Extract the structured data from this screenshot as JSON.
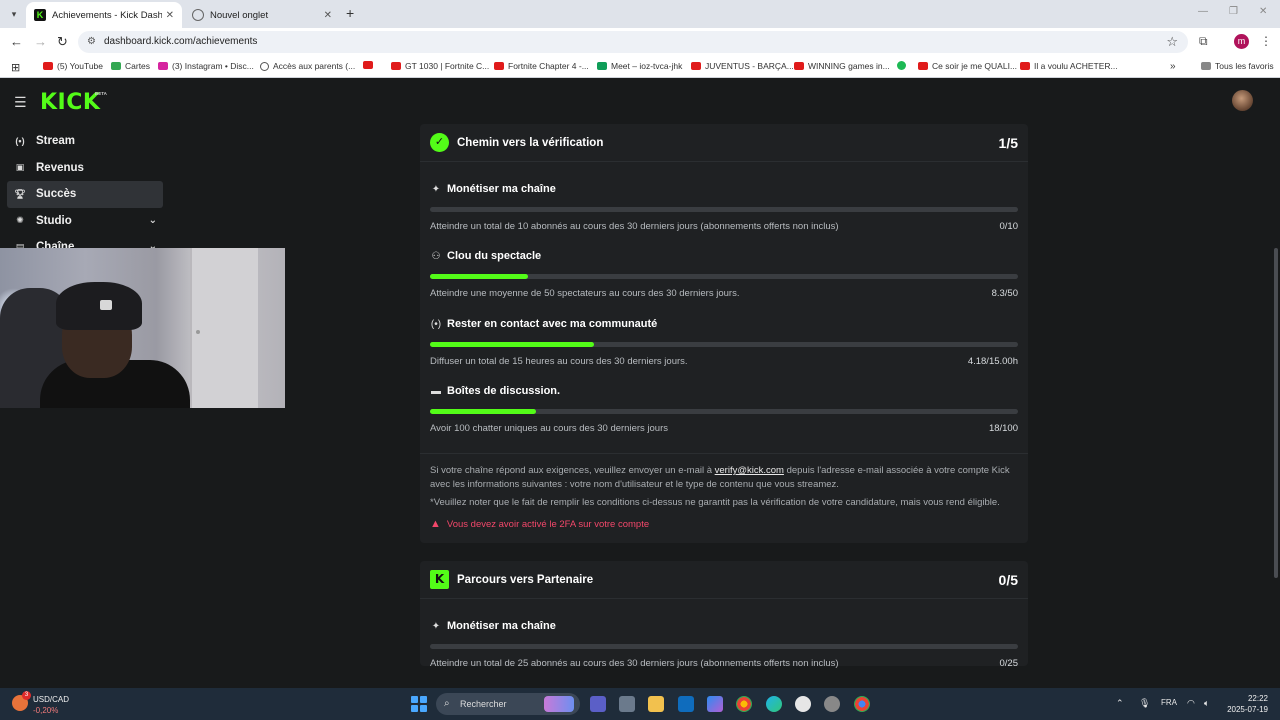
{
  "browser": {
    "tabs": [
      {
        "title": "Achievements - Kick Dashboard",
        "active": true
      },
      {
        "title": "Nouvel onglet",
        "active": false
      }
    ],
    "url": "dashboard.kick.com/achievements",
    "profile_initial": "m",
    "bookmarks": [
      {
        "label": "(5) YouTube",
        "icon": "youtube-icon"
      },
      {
        "label": "Cartes",
        "icon": "maps-icon"
      },
      {
        "label": "(3) Instagram • Disc...",
        "icon": "instagram-icon"
      },
      {
        "label": "Accès aux parents (...",
        "icon": "globe-icon"
      },
      {
        "label": "",
        "icon": "youtube-icon"
      },
      {
        "label": "GT 1030 | Fortnite C...",
        "icon": "youtube-icon"
      },
      {
        "label": "Fortnite Chapter 4 -...",
        "icon": "youtube-icon"
      },
      {
        "label": "Meet – ioz-tvca-jhk",
        "icon": "meet-icon"
      },
      {
        "label": "JUVENTUS - BARÇA...",
        "icon": "youtube-icon"
      },
      {
        "label": "WINNING games in...",
        "icon": "youtube-icon"
      },
      {
        "label": "",
        "icon": "spotify-icon"
      },
      {
        "label": "Ce soir je me QUALI...",
        "icon": "youtube-icon"
      },
      {
        "label": "Il a voulu ACHETER...",
        "icon": "youtube-icon"
      }
    ],
    "all_bookmarks_label": "Tous les favoris"
  },
  "header": {
    "logo": "KICK",
    "logo_badge": "BETA"
  },
  "sidebar": {
    "items": [
      {
        "label": "Stream",
        "icon": "broadcast-icon",
        "active": false
      },
      {
        "label": "Revenus",
        "icon": "wallet-icon",
        "active": false
      },
      {
        "label": "Succès",
        "icon": "trophy-icon",
        "active": true
      },
      {
        "label": "Studio",
        "icon": "studio-icon",
        "active": false,
        "expandable": true
      },
      {
        "label": "Chaîne",
        "icon": "channel-icon",
        "active": false,
        "expandable": true
      }
    ]
  },
  "verification": {
    "title": "Chemin vers la vérification",
    "count": "1/5",
    "goals": [
      {
        "title": "Monétiser ma chaîne",
        "icon": "sparkle-icon",
        "desc": "Atteindre un total de 10 abonnés au cours des 30 derniers jours (abonnements offerts non inclus)",
        "value": "0/10",
        "progress": 0
      },
      {
        "title": "Clou du spectacle",
        "icon": "viewers-icon",
        "desc": "Atteindre une moyenne de 50 spectateurs au cours des 30 derniers jours.",
        "value": "8.3/50",
        "progress": 0.166
      },
      {
        "title": "Rester en contact avec ma communauté",
        "icon": "broadcast-icon",
        "desc": "Diffuser un total de 15 heures au cours des 30 derniers jours.",
        "value": "4.18/15.00h",
        "progress": 0.279
      },
      {
        "title": "Boîtes de discussion.",
        "icon": "chat-icon",
        "desc": "Avoir 100 chatter uniques au cours des 30 derniers jours",
        "value": "18/100",
        "progress": 0.18
      }
    ],
    "note_before_link": "Si votre chaîne répond aux exigences, veuillez envoyer un e-mail à ",
    "note_link": "verify@kick.com",
    "note_after_link": " depuis l'adresse e-mail associée à votre compte Kick avec les informations suivantes : votre nom d'utilisateur et le type de contenu que vous streamez.",
    "disclaimer": "*Veuillez noter que le fait de remplir les conditions ci-dessus ne garantit pas la vérification de votre candidature, mais vous rend éligible.",
    "warning": "Vous devez avoir activé le 2FA sur votre compte"
  },
  "partner": {
    "title": "Parcours vers Partenaire",
    "count": "0/5",
    "goals": [
      {
        "title": "Monétiser ma chaîne",
        "icon": "sparkle-icon",
        "desc": "Atteindre un total de 25 abonnés au cours des 30 derniers jours (abonnements offerts non inclus)",
        "value": "0/25",
        "progress": 0
      }
    ]
  },
  "taskbar": {
    "ticker_name": "USD/CAD",
    "ticker_change": "-0,20%",
    "ticker_badge": "3",
    "search_placeholder": "Rechercher",
    "language": "FRA",
    "time": "22:22",
    "date": "2025-07-19"
  },
  "colors": {
    "accent": "#53fc18",
    "warning": "#f2476a",
    "background": "#181a1b",
    "card": "#1f2123"
  }
}
